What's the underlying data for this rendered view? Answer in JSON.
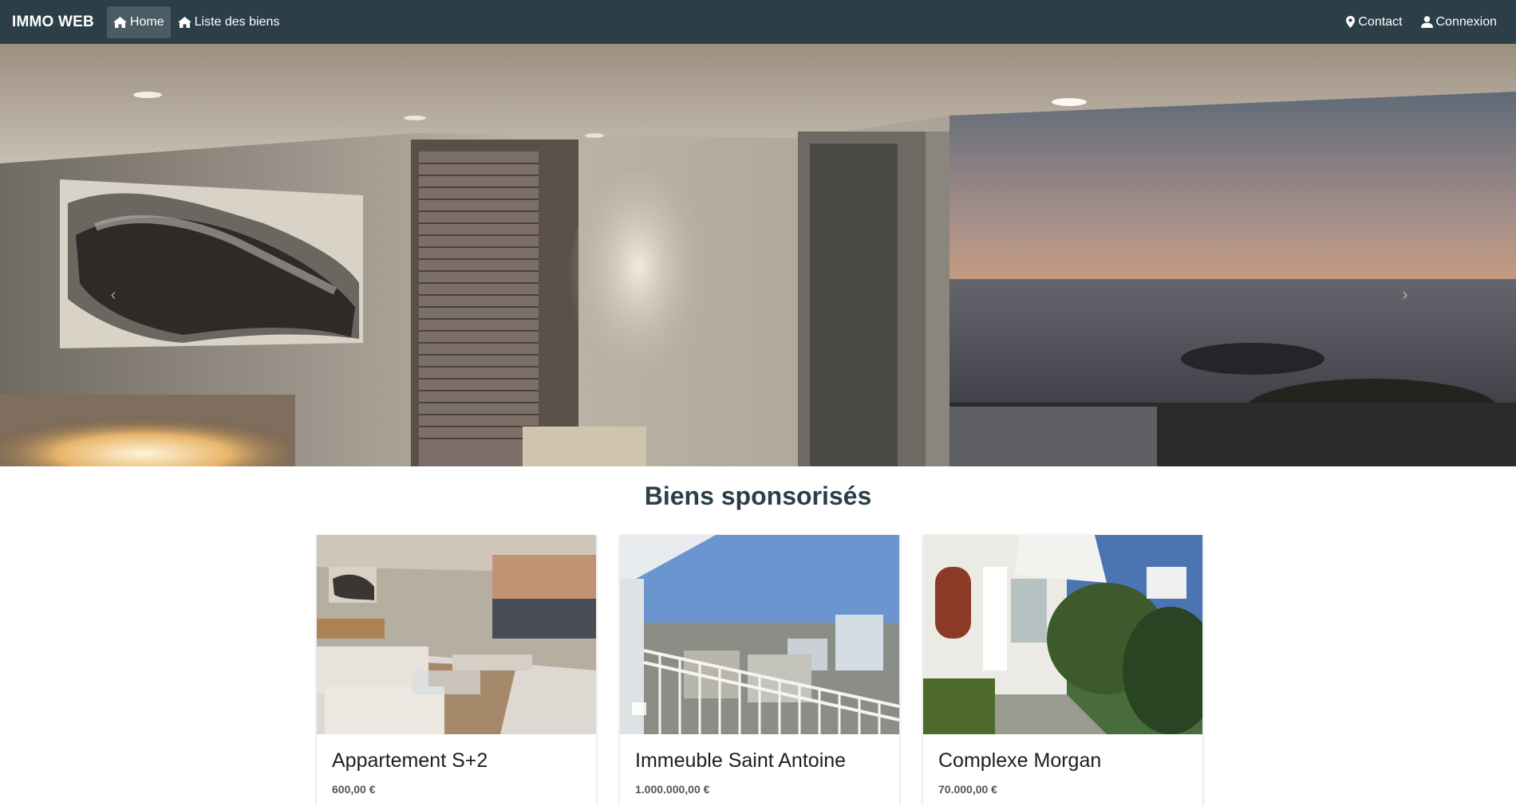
{
  "navbar": {
    "brand": "IMMO WEB",
    "links": [
      {
        "label": "Home",
        "icon": "home-icon",
        "active": true
      },
      {
        "label": "Liste des biens",
        "icon": "home-icon",
        "active": false
      }
    ],
    "right_links": [
      {
        "label": "Contact",
        "icon": "map-marker-icon"
      },
      {
        "label": "Connexion",
        "icon": "user-icon"
      }
    ],
    "colors": {
      "background": "#2c3e48",
      "active": "#4b5b64"
    }
  },
  "carousel": {
    "prev_symbol": "‹",
    "next_symbol": "›"
  },
  "section": {
    "title": "Biens sponsorisés"
  },
  "cards": [
    {
      "title": "Appartement S+2",
      "price": "600,00 €"
    },
    {
      "title": "Immeuble Saint Antoine",
      "price": "1.000.000,00 €"
    },
    {
      "title": "Complexe Morgan",
      "price": "70.000,00 €"
    }
  ]
}
